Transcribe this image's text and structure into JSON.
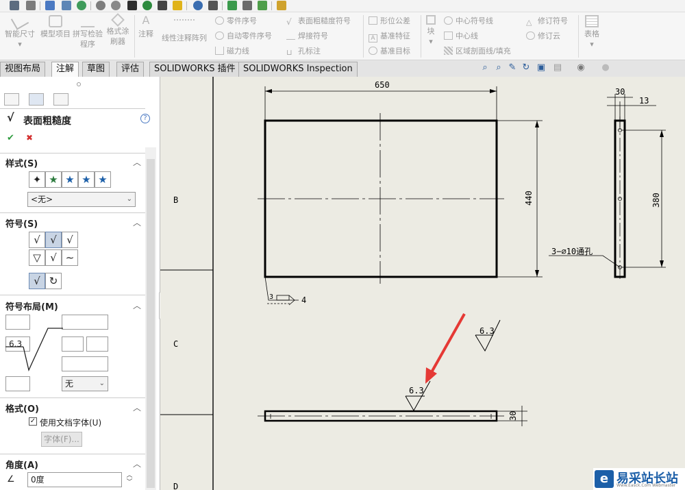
{
  "quick_access": {
    "icons": [
      "arrow-icon",
      "sketch-icon",
      "save-icon",
      "rebuild-icon",
      "globe-icon",
      "options-icon",
      "gear-icon",
      "filter-icon",
      "pin-icon",
      "dimension-icon",
      "group-icon",
      "zoom-icon",
      "select-icon",
      "window-icon",
      "camera-icon",
      "doc-icon"
    ]
  },
  "ribbon": {
    "smart_dimension": "智能尺寸",
    "model_items": "模型项目",
    "spell_check": "拼写检验程序",
    "format_painter": "格式涂刷器",
    "note": "注释",
    "linear_note_pattern": "线性注释阵列",
    "balloon": "零件序号",
    "auto_balloon": "自动零件序号",
    "magnetic_line": "磁力线",
    "surface_finish": "表面粗糙度符号",
    "weld_symbol": "焊接符号",
    "hole_callout": "孔标注",
    "gtol": "形位公差",
    "datum_feature": "基准特征",
    "datum_target": "基准目标",
    "block": "块",
    "center_mark": "中心符号线",
    "centerline": "中心线",
    "area_hatch": "区域剖面线/填充",
    "revision_symbol": "修订符号",
    "revision_cloud": "修订云",
    "tables": "表格"
  },
  "tabs": [
    "视图布局",
    "注解",
    "草图",
    "评估",
    "SOLIDWORKS 插件",
    "SOLIDWORKS Inspection"
  ],
  "active_tab": "注解",
  "panel": {
    "title": "表面粗糙度",
    "ok": "✔",
    "cancel": "✖",
    "help": "?",
    "style_section": "样式(S)",
    "style_value": "<无>",
    "symbol_section": "符号(S)",
    "layout_section": "符号布局(M)",
    "roughness_value": "6.3",
    "lay_direction": "无",
    "format_section": "格式(O)",
    "use_doc_font": "使用文档字体(U)",
    "font_button": "字体(F)...",
    "angle_section": "角度(A)",
    "angle_value": "0度"
  },
  "drawing": {
    "zone_b": "B",
    "zone_c": "C",
    "zone_d": "D",
    "dim_650": "650",
    "dim_440": "440",
    "dim_30_top": "30",
    "dim_13": "13",
    "dim_380": "380",
    "hole_callout": "3−∅10通孔",
    "weld_3": "3",
    "weld_4": "4",
    "finish_free": "6.3",
    "finish_attached": "6.3",
    "dim_30_bottom": "30",
    "arrow_color": "#e53935",
    "line_color": "#000000"
  },
  "watermark": {
    "logo": "e",
    "name": "易采站长站",
    "sub": "Www.Easck.Com Webmaster"
  }
}
